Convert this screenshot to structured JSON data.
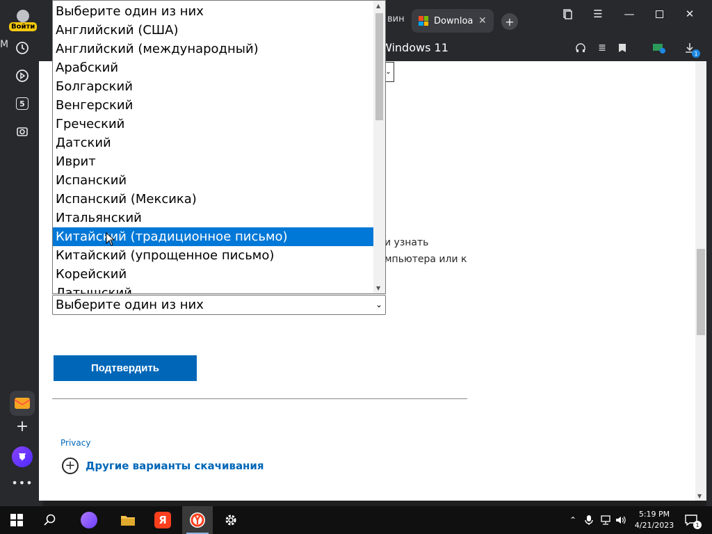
{
  "browser": {
    "login_label": "Войти",
    "rail_letter": "М",
    "tab_partial": "вин",
    "active_tab_title": "Download",
    "address_title": "Windows 11",
    "new_tab": "+",
    "downloads_count": "1",
    "rail_badge": "5"
  },
  "page": {
    "para_line1": "и узнать",
    "para_line2": "мпьютера или к",
    "language_select_value": "Выберите один из них",
    "confirm_button": "Подтвердить",
    "privacy_link": "Privacy",
    "more_downloads": "Другие варианты скачивания"
  },
  "dropdown": {
    "selected_index": 12,
    "options": [
      "Выберите один из них",
      "Английский (США)",
      "Английский (международный)",
      "Арабский",
      "Болгарский",
      "Венгерский",
      "Греческий",
      "Датский",
      "Иврит",
      "Испанский",
      "Испанский (Мексика)",
      "Итальянский",
      "Китайский (традиционное письмо)",
      "Китайский (упрощенное письмо)",
      "Корейский",
      "Латышский"
    ]
  },
  "taskbar": {
    "time": "5:19 PM",
    "date": "4/21/2023",
    "notifications": "1",
    "yandex_letter": "Я"
  },
  "colors": {
    "accent": "#0067b8",
    "selection": "#0078d7",
    "chrome": "#27292d"
  }
}
